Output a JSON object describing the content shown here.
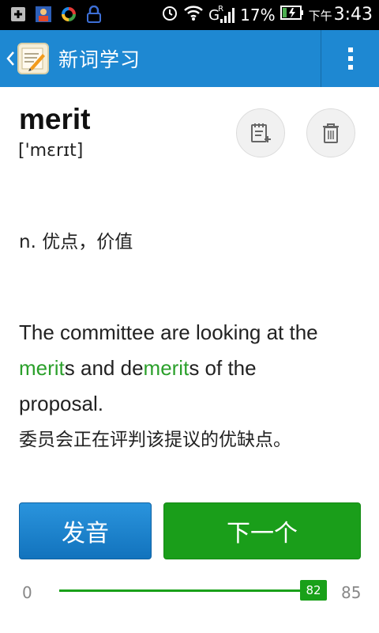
{
  "status_bar": {
    "icons": [
      "plus-box-icon",
      "contacts-icon",
      "sync-icon",
      "lock-icon",
      "alarm-icon",
      "wifi-icon",
      "signal-icon",
      "battery-icon"
    ],
    "network": "G",
    "roaming": "R",
    "battery": "17%",
    "time_prefix": "下午",
    "time": "3:43"
  },
  "action_bar": {
    "title": "新词学习",
    "color": "#1e88d2"
  },
  "word": {
    "text": "merit",
    "phonetic": "['mɛrɪt]"
  },
  "actions": {
    "notes_icon": "add-note-icon",
    "delete_icon": "trash-icon"
  },
  "definition": "n. 优点，价值",
  "example": {
    "line1": "The committee are looking at the",
    "hl1": "merit",
    "s1": "s and de",
    "hl2": "merit",
    "s2": "s of the",
    "line3": "proposal.",
    "highlight_color": "#2ba02b"
  },
  "translation": "委员会正在评判该提议的优缺点。",
  "buttons": {
    "speak": "发音",
    "next": "下一个"
  },
  "progress": {
    "min": "0",
    "max": "85",
    "value": 82,
    "value_label": "82"
  }
}
